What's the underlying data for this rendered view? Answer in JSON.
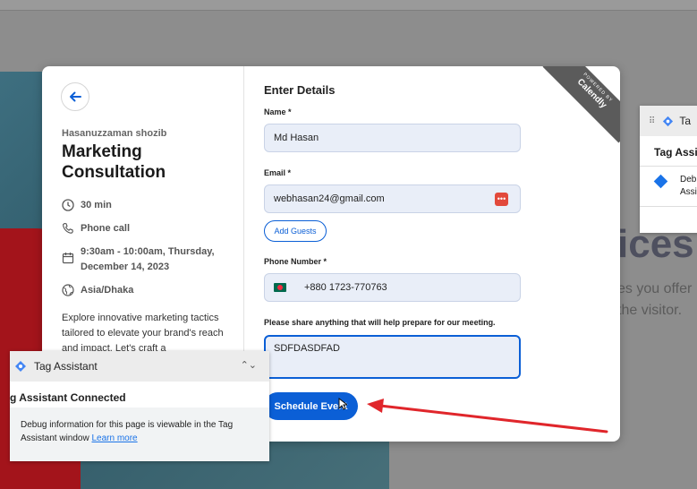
{
  "background": {
    "heading": "ices",
    "sub_line1": "es you offer",
    "sub_line2": "the visitor."
  },
  "event": {
    "host": "Hasanuzzaman shozib",
    "title": "Marketing Consultation",
    "duration": "30 min",
    "location": "Phone call",
    "datetime": "9:30am - 10:00am, Thursday, December 14, 2023",
    "timezone": "Asia/Dhaka",
    "description": "Explore innovative marketing tactics tailored to elevate your brand's reach and impact. Let's craft a"
  },
  "form": {
    "section_title": "Enter Details",
    "name_label": "Name *",
    "name_value": "Md Hasan",
    "email_label": "Email *",
    "email_value": "webhasan24@gmail.com",
    "add_guests_label": "Add Guests",
    "phone_label": "Phone Number *",
    "phone_value": "+880 1723-770763",
    "notes_label": "Please share anything that will help prepare for our meeting.",
    "notes_value": "SDFDASDFAD",
    "schedule_button": "Schedule Event"
  },
  "ribbon": {
    "powered_by": "POWERED BY",
    "brand": "Calendly"
  },
  "tag_assistant": {
    "title": "Tag Assistant",
    "status": "g Assistant Connected",
    "debug_text": "Debug information for this page is viewable in the Tag Assistant window",
    "learn_more": "Learn more"
  },
  "tag_assistant_right": {
    "title": "Ta",
    "subtitle": "Tag Assis",
    "item_line1": "Deb",
    "item_line2": "Assi"
  },
  "colors": {
    "accent": "#0b5fd6",
    "annotation_arrow": "#e0262b"
  }
}
